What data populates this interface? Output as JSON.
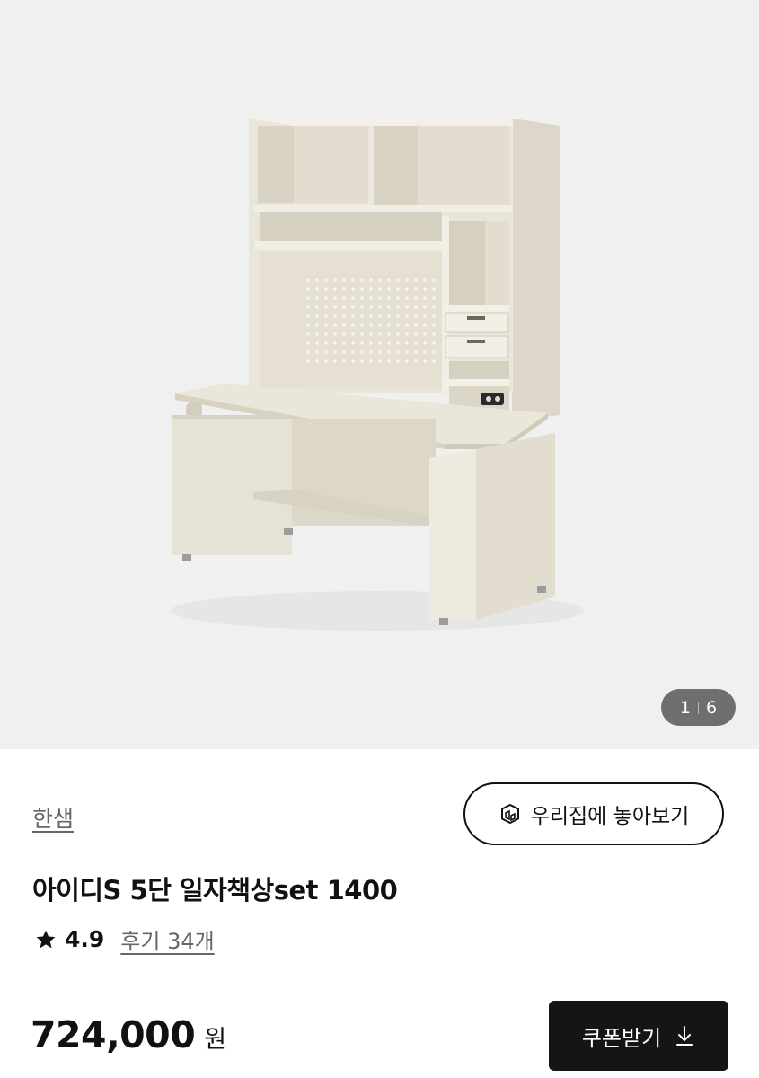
{
  "gallery": {
    "image_alt": "아이디S 5단 일자책상set 1400",
    "current": "1",
    "total": "6"
  },
  "product": {
    "brand": "한샘",
    "title": "아이디S 5단 일자책상set 1400",
    "rating": "4.9",
    "reviews": "후기 34개",
    "price": "724,000",
    "currency": "원"
  },
  "actions": {
    "ar_view": "우리집에 놓아보기",
    "coupon": "쿠폰받기"
  },
  "icons": {
    "ar": "3d-cube-icon",
    "star": "star-icon",
    "download": "download-arrow-icon"
  },
  "colors": {
    "gallery_bg": "#f0f0f0",
    "desk_body": "#e8e3d6",
    "primary_button": "#151515",
    "counter_bg": "#6f6f6f"
  }
}
